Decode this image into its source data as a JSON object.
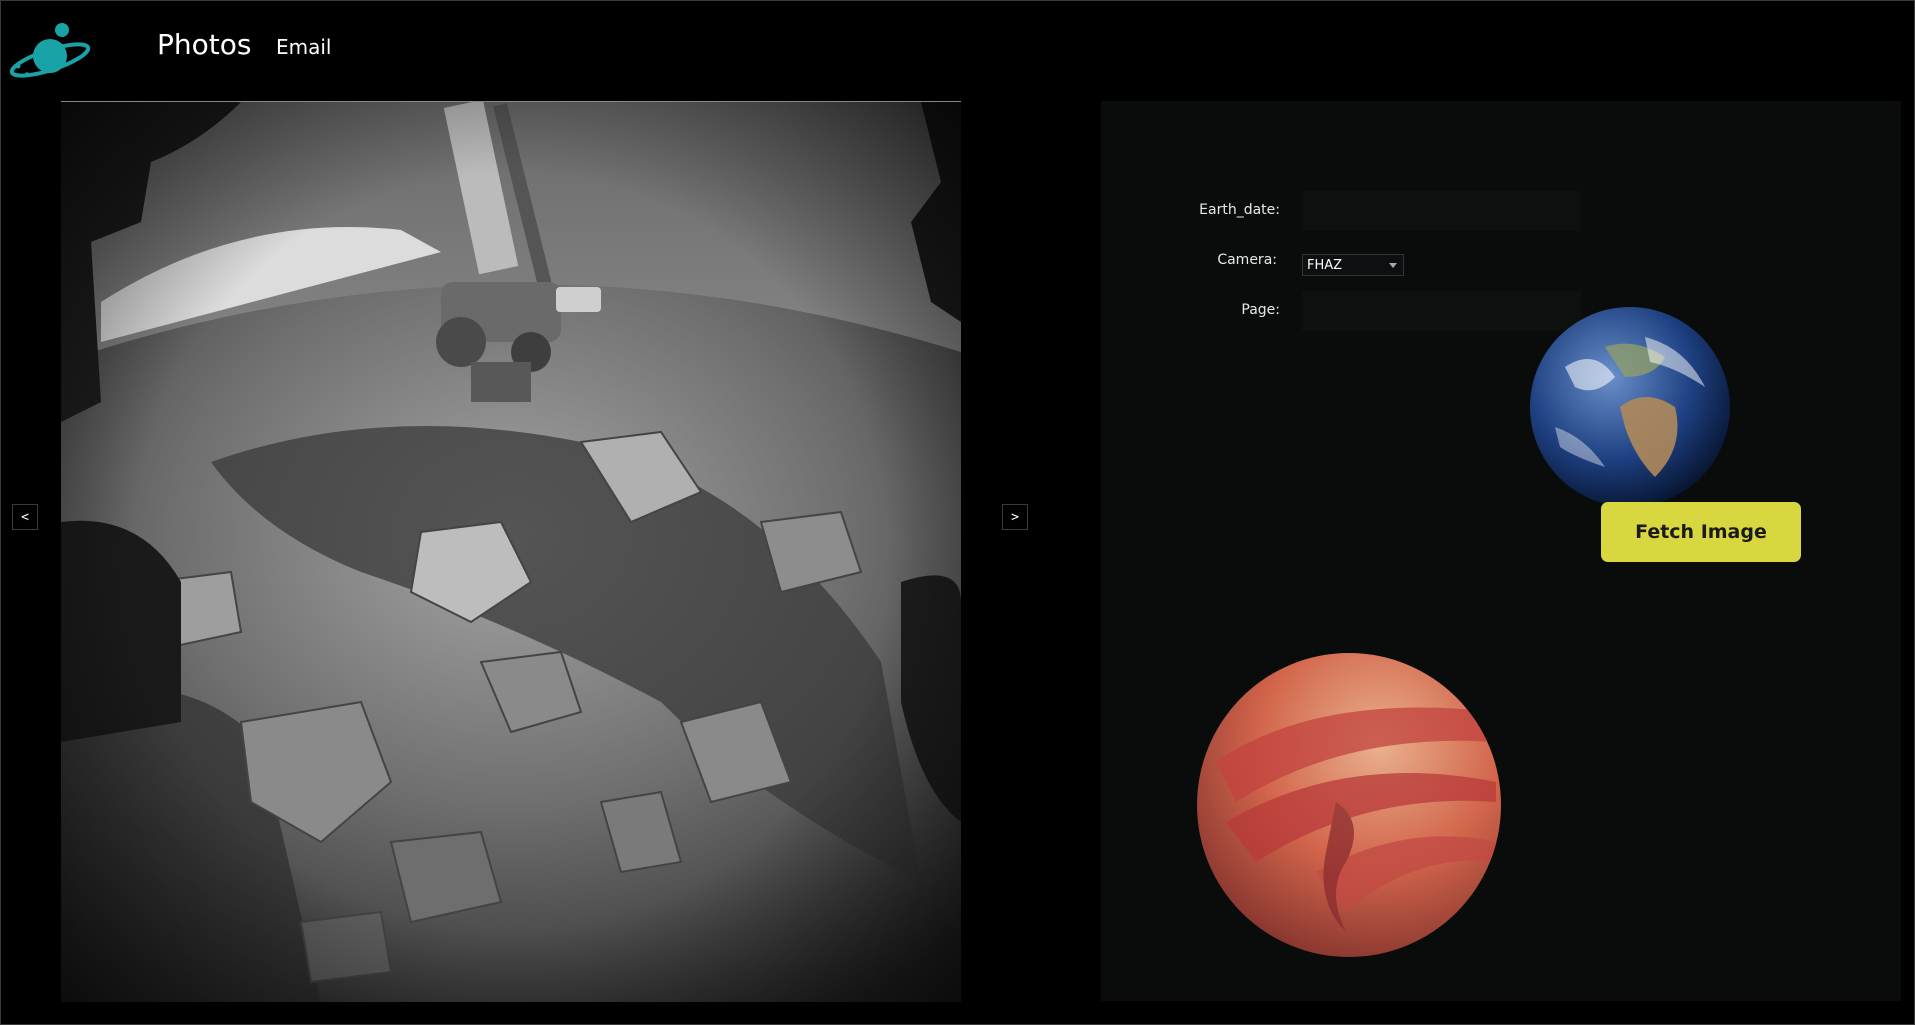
{
  "header": {
    "logo_icon": "ringed-planet-icon",
    "nav": {
      "photos_label": "Photos",
      "email_label": "Email"
    }
  },
  "viewer": {
    "prev_label": "<",
    "next_label": ">",
    "photo_description_icon": "rover-photo"
  },
  "form": {
    "earth_date_label": "Earth_date:",
    "earth_date_value": "",
    "camera_label": "Camera:",
    "camera_selected": "FHAZ",
    "page_label": "Page:",
    "page_value": "",
    "fetch_label": "Fetch Image"
  },
  "colors": {
    "accent_button": "#d8d73f",
    "logo": "#1aa3a6",
    "panel_bg": "#0a0c0b"
  }
}
